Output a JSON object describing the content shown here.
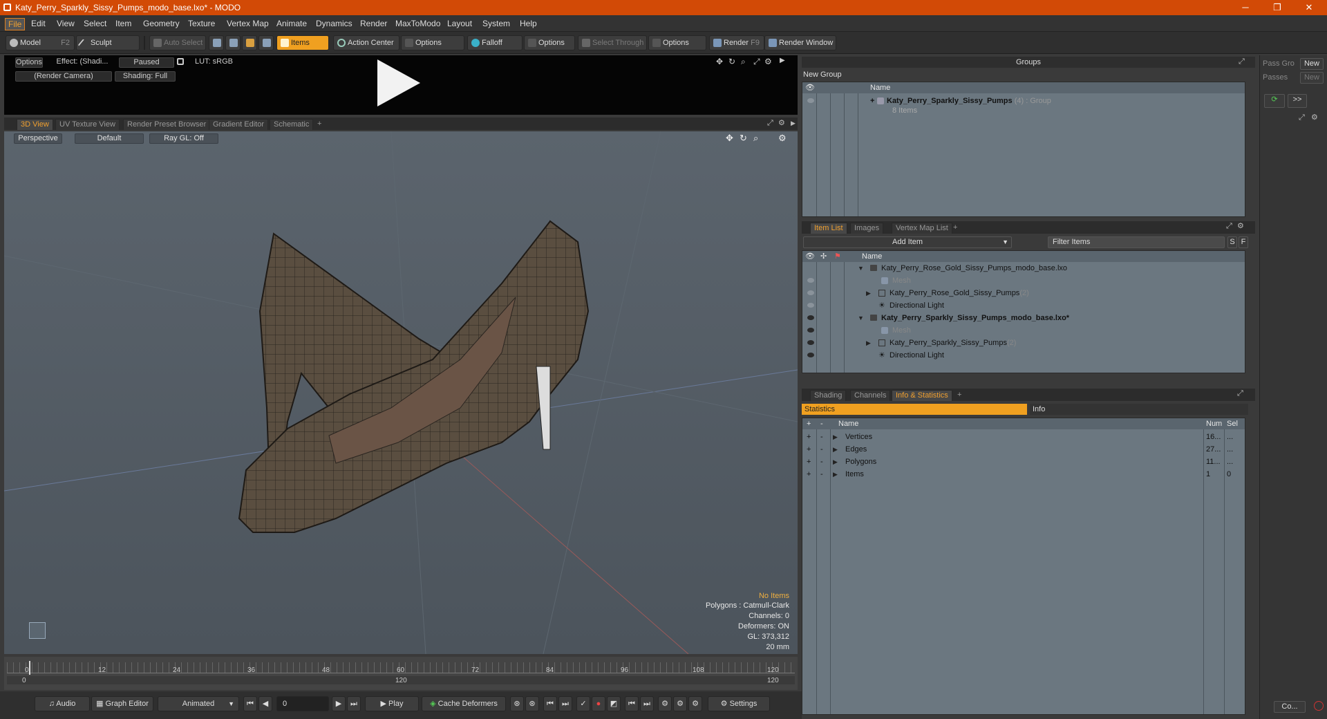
{
  "window": {
    "title": "Katy_Perry_Sparkly_Sissy_Pumps_modo_base.lxo* - MODO",
    "min": "─",
    "max": "❐",
    "close": "✕"
  },
  "menu": [
    "File",
    "Edit",
    "View",
    "Select",
    "Item",
    "Geometry",
    "Texture",
    "Vertex Map",
    "Animate",
    "Dynamics",
    "Render",
    "MaxToModo",
    "Layout",
    "System",
    "Help"
  ],
  "toolbar": {
    "model": "Model",
    "model_key": "F2",
    "sculpt": "Sculpt",
    "auto_select": "Auto Select",
    "items": "Items",
    "action_center": "Action Center",
    "options1": "Options",
    "falloff": "Falloff",
    "options2": "Options",
    "select_through": "Select Through",
    "options3": "Options",
    "render": "Render",
    "render_key": "F9",
    "render_window": "Render Window"
  },
  "preview": {
    "options": "Options",
    "effect": "Effect: (Shadi...",
    "paused": "Paused",
    "lut": "LUT: sRGB",
    "camera": "(Render Camera)",
    "shading": "Shading: Full"
  },
  "viewtabs": [
    "3D View",
    "UV Texture View",
    "Render Preset Browser",
    "Gradient Editor",
    "Schematic",
    "+"
  ],
  "viewport": {
    "perspective": "Perspective",
    "default": "Default",
    "raygl": "Ray GL: Off",
    "no_items": "No Items",
    "polygons": "Polygons : Catmull-Clark",
    "channels": "Channels: 0",
    "deformers": "Deformers: ON",
    "gl": "GL: 373,312",
    "scale": "20 mm"
  },
  "timeline": {
    "ticks": [
      "0",
      "12",
      "24",
      "36",
      "48",
      "60",
      "72",
      "84",
      "96",
      "108",
      "120"
    ],
    "low": [
      "0",
      "120",
      "120"
    ]
  },
  "bottom": {
    "audio": "Audio",
    "graph": "Graph Editor",
    "animated": "Animated",
    "frame": "0",
    "play": "Play",
    "cache": "Cache Deformers",
    "settings": "Settings"
  },
  "groups": {
    "title": "Groups",
    "new_group": "New Group",
    "col_name": "Name",
    "item": "Katy_Perry_Sparkly_Sissy_Pumps",
    "count": "(4)",
    "type": ": Group",
    "sub": "8 Items"
  },
  "passes": {
    "pass_gro": "Pass Gro",
    "new1": "New",
    "passes": "Passes",
    "new2": "New",
    "arrows": ">>"
  },
  "itemtabs": [
    "Item List",
    "Images",
    "Vertex Map List",
    "+"
  ],
  "itemlist": {
    "add_item": "Add Item",
    "filter": "Filter Items",
    "s": "S",
    "f": "F",
    "col_name": "Name",
    "rows": [
      {
        "label": "Katy_Perry_Rose_Gold_Sissy_Pumps_modo_base.lxo",
        "extra": ""
      },
      {
        "label": "Mesh",
        "extra": ""
      },
      {
        "label": "Katy_Perry_Rose_Gold_Sissy_Pumps",
        "extra": "(2)"
      },
      {
        "label": "Directional Light",
        "extra": ""
      },
      {
        "label": "Katy_Perry_Sparkly_Sissy_Pumps_modo_base.lxo*",
        "extra": ""
      },
      {
        "label": "Mesh",
        "extra": ""
      },
      {
        "label": "Katy_Perry_Sparkly_Sissy_Pumps",
        "extra": "(2)"
      },
      {
        "label": "Directional Light",
        "extra": ""
      }
    ]
  },
  "stattabs": [
    "Shading",
    "Channels",
    "Info & Statistics",
    "+"
  ],
  "stats": {
    "statistics": "Statistics",
    "info": "Info",
    "col_name": "Name",
    "col_num": "Num",
    "col_sel": "Sel",
    "rows": [
      {
        "name": "Vertices",
        "num": "16...",
        "sel": "..."
      },
      {
        "name": "Edges",
        "num": "27...",
        "sel": "..."
      },
      {
        "name": "Polygons",
        "num": "11...",
        "sel": "..."
      },
      {
        "name": "Items",
        "num": "1",
        "sel": "0"
      }
    ]
  },
  "rightstrip": {
    "co": "Co..."
  }
}
